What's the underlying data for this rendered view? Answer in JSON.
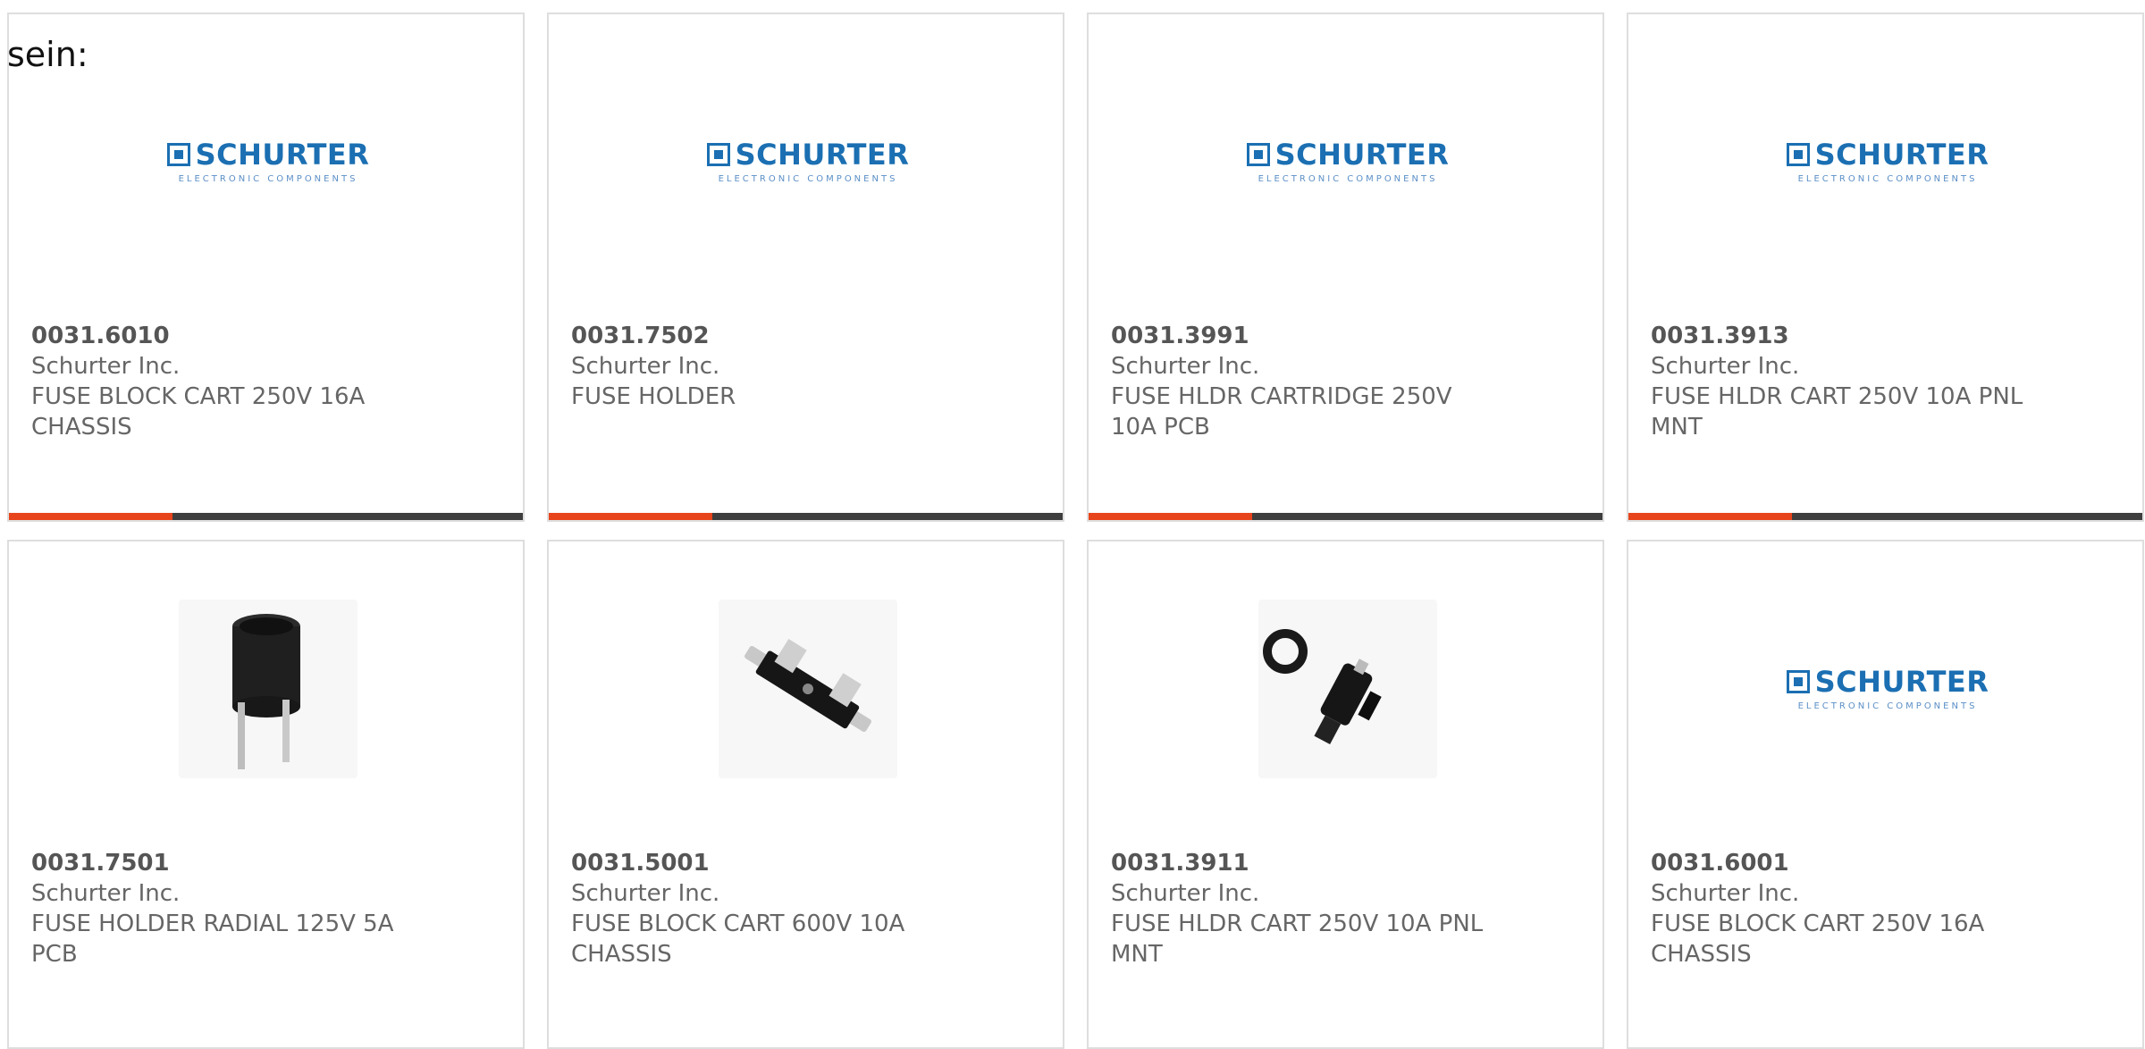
{
  "intro_text": "sein:",
  "colors": {
    "brand_blue": "#1b6fb2",
    "accent_orange": "#e8441c",
    "bar_dark": "#3e3e3e"
  },
  "logo": {
    "brand": "SCHURTER",
    "subtitle": "ELECTRONIC COMPONENTS"
  },
  "products": [
    {
      "part_number": "0031.6010",
      "manufacturer": "Schurter Inc.",
      "description": "FUSE BLOCK CART 250V 16A CHASSIS",
      "image": "schurter-logo",
      "show_bar": true
    },
    {
      "part_number": "0031.7502",
      "manufacturer": "Schurter Inc.",
      "description": "FUSE HOLDER",
      "image": "schurter-logo",
      "show_bar": true
    },
    {
      "part_number": "0031.3991",
      "manufacturer": "Schurter Inc.",
      "description": "FUSE HLDR CARTRIDGE 250V 10A PCB",
      "image": "schurter-logo",
      "show_bar": true
    },
    {
      "part_number": "0031.3913",
      "manufacturer": "Schurter Inc.",
      "description": "FUSE HLDR CART 250V 10A PNL MNT",
      "image": "schurter-logo",
      "show_bar": true
    },
    {
      "part_number": "0031.7501",
      "manufacturer": "Schurter Inc.",
      "description": "FUSE HOLDER RADIAL 125V 5A PCB",
      "image": "radial-fuse-holder-photo",
      "show_bar": false
    },
    {
      "part_number": "0031.5001",
      "manufacturer": "Schurter Inc.",
      "description": "FUSE BLOCK CART 600V 10A CHASSIS",
      "image": "fuse-block-photo",
      "show_bar": false
    },
    {
      "part_number": "0031.3911",
      "manufacturer": "Schurter Inc.",
      "description": "FUSE HLDR CART 250V 10A PNL MNT",
      "image": "panel-fuse-holder-photo",
      "show_bar": false
    },
    {
      "part_number": "0031.6001",
      "manufacturer": "Schurter Inc.",
      "description": "FUSE BLOCK CART 250V 16A CHASSIS",
      "image": "schurter-logo",
      "show_bar": false
    }
  ]
}
